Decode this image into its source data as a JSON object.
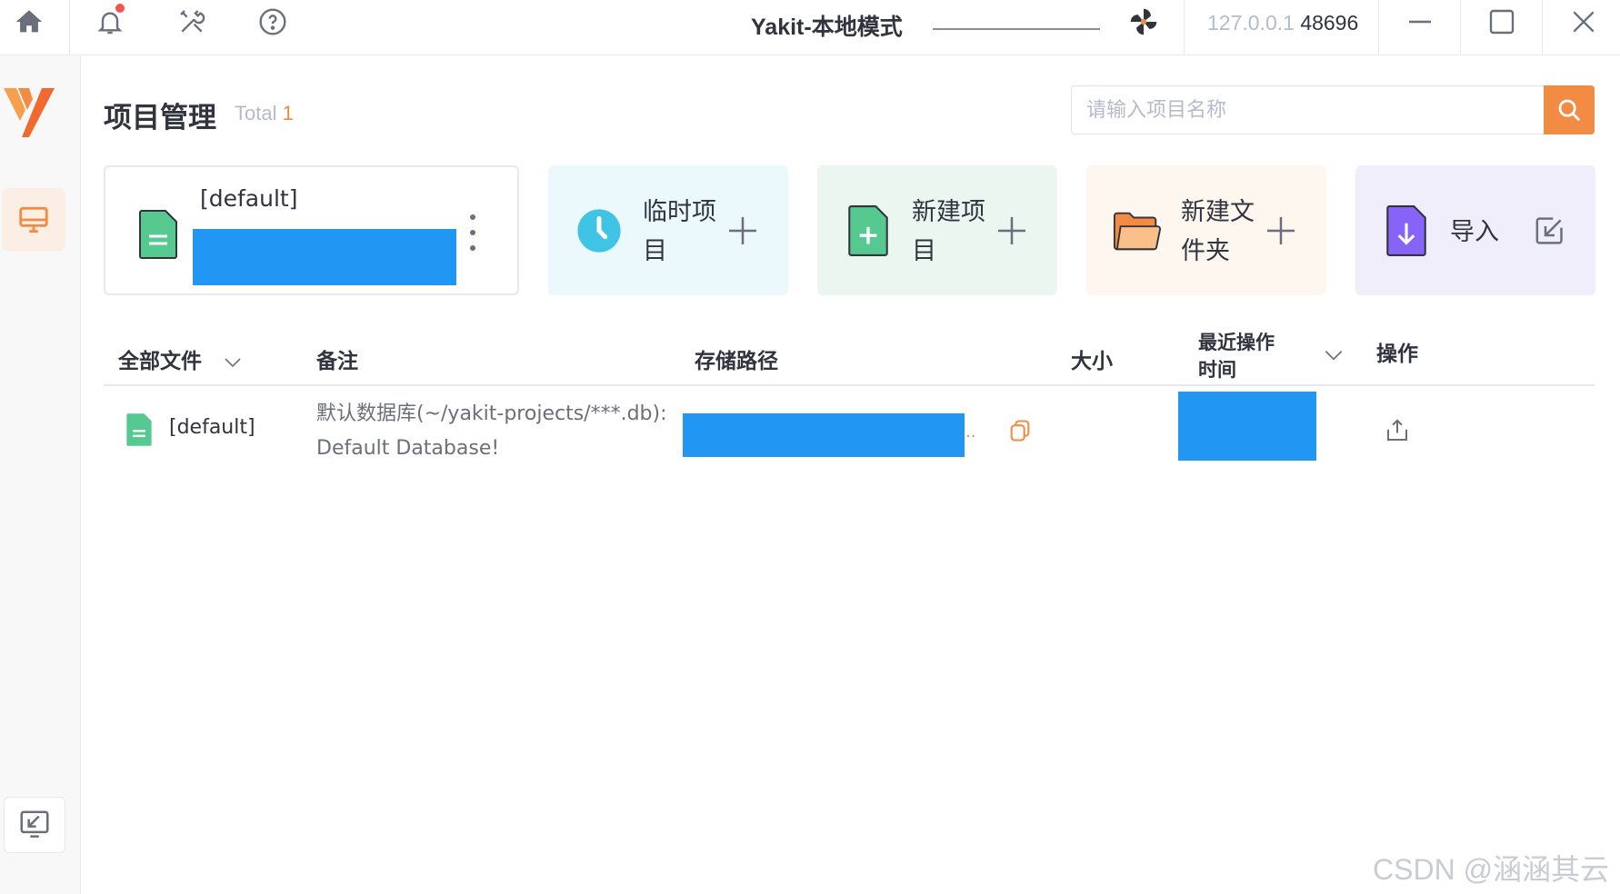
{
  "window": {
    "title": "Yakit-本地模式",
    "host": "127.0.0.1",
    "port": "48696"
  },
  "titlebar_icons": [
    "home-icon",
    "bell-icon",
    "tools-icon",
    "help-icon",
    "pinwheel-icon",
    "minimize-icon",
    "maximize-icon",
    "close-icon"
  ],
  "page": {
    "title": "项目管理",
    "total_label": "Total",
    "total_count": "1"
  },
  "search": {
    "placeholder": "请输入项目名称"
  },
  "current_project": {
    "name": "[default]"
  },
  "actions": [
    {
      "label": "临时项目",
      "icon": "clock-icon",
      "color": "#40c4e5"
    },
    {
      "label": "新建项目",
      "icon": "file-plus-icon",
      "color": "#56c991"
    },
    {
      "label": "新建文件夹",
      "icon": "folder-icon",
      "color": "#f28b44"
    },
    {
      "label": "导入",
      "icon": "import-icon",
      "color": "#8863f7"
    }
  ],
  "table": {
    "headers": {
      "file": "全部文件",
      "note": "备注",
      "path": "存储路径",
      "size": "大小",
      "time": "最近操作时间",
      "ops": "操作"
    },
    "rows": [
      {
        "name": "[default]",
        "note": "默认数据库(~/yakit-projects/***.db): Default Database!",
        "path_ellipsis": "..",
        "size": ""
      }
    ]
  },
  "watermark": "CSDN @涵涵其云",
  "colors": {
    "accent": "#f28b44",
    "redaction": "#2196f3",
    "green": "#56c991",
    "purple": "#8863f7",
    "cyan": "#40c4e5"
  }
}
